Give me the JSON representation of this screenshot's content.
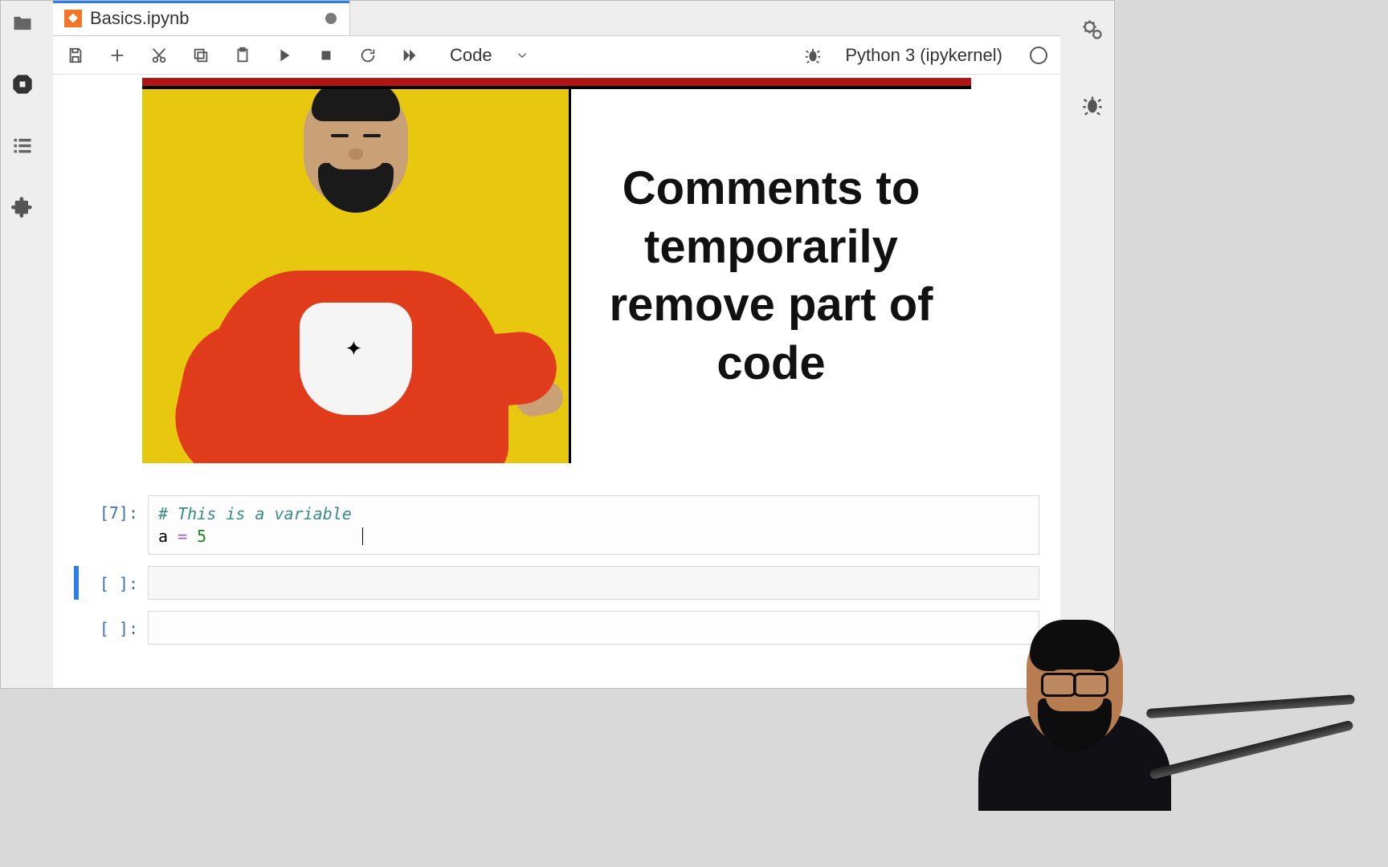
{
  "tab": {
    "title": "Basics.ipynb"
  },
  "toolbar": {
    "celltype": "Code",
    "kernel": "Python 3 (ipykernel)"
  },
  "meme": {
    "text": "Comments to temporarily remove part of code"
  },
  "cells": [
    {
      "prompt": "[7]:",
      "line1_comment": "# This is a variable",
      "line2_var": "a ",
      "line2_op": "=",
      "line2_num": " 5"
    },
    {
      "prompt": "[ ]:"
    },
    {
      "prompt": "[ ]:"
    }
  ]
}
